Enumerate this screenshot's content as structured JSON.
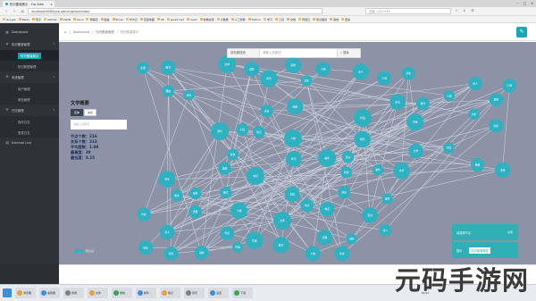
{
  "browser": {
    "tab_title": "知识图谱展示 - Yiw Adm",
    "url": "localhost:8080/yiw-admin/graph/index",
    "search_placeholder": "百度 <Ctrl+K>",
    "bookmarks": [
      "Google",
      "Baidu",
      "知乎",
      "GitHub",
      "CSDN",
      "Docs",
      "博客园",
      "掘金",
      "Email",
      "华为云",
      "百度地图",
      "AE",
      "JavaScript",
      "react",
      "前端资源",
      "大数据",
      "人工智能",
      "Python",
      "学习",
      "工具",
      "文档",
      "阿里云",
      "知识图谱",
      "其他",
      "更多"
    ]
  },
  "sidebar": {
    "items": [
      {
        "label": "Dashboard",
        "icon": "dashboard-icon",
        "level": 0
      },
      {
        "label": "知识图谱管理",
        "icon": "graph-icon",
        "level": 0
      },
      {
        "label": "知识图谱展示",
        "icon": "dot-icon",
        "level": 1,
        "active": true
      },
      {
        "label": "知识数据管理",
        "icon": "dot-icon",
        "level": 1
      },
      {
        "label": "系统管理",
        "icon": "gear-icon",
        "level": 0
      },
      {
        "label": "用户管理",
        "icon": "dot-icon",
        "level": 1
      },
      {
        "label": "角色管理",
        "icon": "dot-icon",
        "level": 1
      },
      {
        "label": "日志管理",
        "icon": "log-icon",
        "level": 0
      },
      {
        "label": "操作日志",
        "icon": "dot-icon",
        "level": 1
      },
      {
        "label": "登录日志",
        "icon": "dot-icon",
        "level": 1
      },
      {
        "label": "External Link",
        "icon": "link-icon",
        "level": 0
      }
    ]
  },
  "header": {
    "home_icon": "home-icon",
    "crumb_root": "Dashboard",
    "crumb_section": "知识图谱管理",
    "crumb_current": "知识图谱展示"
  },
  "graph_search": {
    "type_value": "按标题搜索",
    "placeholder": "请输入关键词",
    "button_label": "搜索"
  },
  "info": {
    "title": "文学概要",
    "tabs": [
      "实体",
      "关系"
    ],
    "input_placeholder": "请输入关键词",
    "stats": [
      "节点个数：216",
      "关系个数：213",
      "平均度数：1.98",
      "最高度：39",
      "最低度：3.15"
    ]
  },
  "legend": {
    "label": "知识点",
    "color": "#2fb1c2"
  },
  "toasts": [
    {
      "label": "请选择节点",
      "action": "关闭"
    },
    {
      "label": "提示",
      "highlight": "知识图谱管理"
    }
  ],
  "node_labels": [
    "人物",
    "事件",
    "地点",
    "作品",
    "朝代",
    "文学",
    "诗人",
    "小说",
    "散文",
    "流派",
    "思想",
    "评论",
    "词牌",
    "典故",
    "经典",
    "年代",
    "作家",
    "文体",
    "主题",
    "意象"
  ],
  "taskbar": {
    "apps": [
      "浏览器",
      "编辑器",
      "终端",
      "文件",
      "微信",
      "邮件",
      "笔记",
      "音乐",
      "设置",
      "下载"
    ],
    "clock": "18:04"
  },
  "watermark": "元码手游网",
  "colors": {
    "accent": "#18a7b5",
    "node": "#2fb1c2",
    "canvas": "#8c93a6",
    "sidebar": "#2f3337"
  }
}
